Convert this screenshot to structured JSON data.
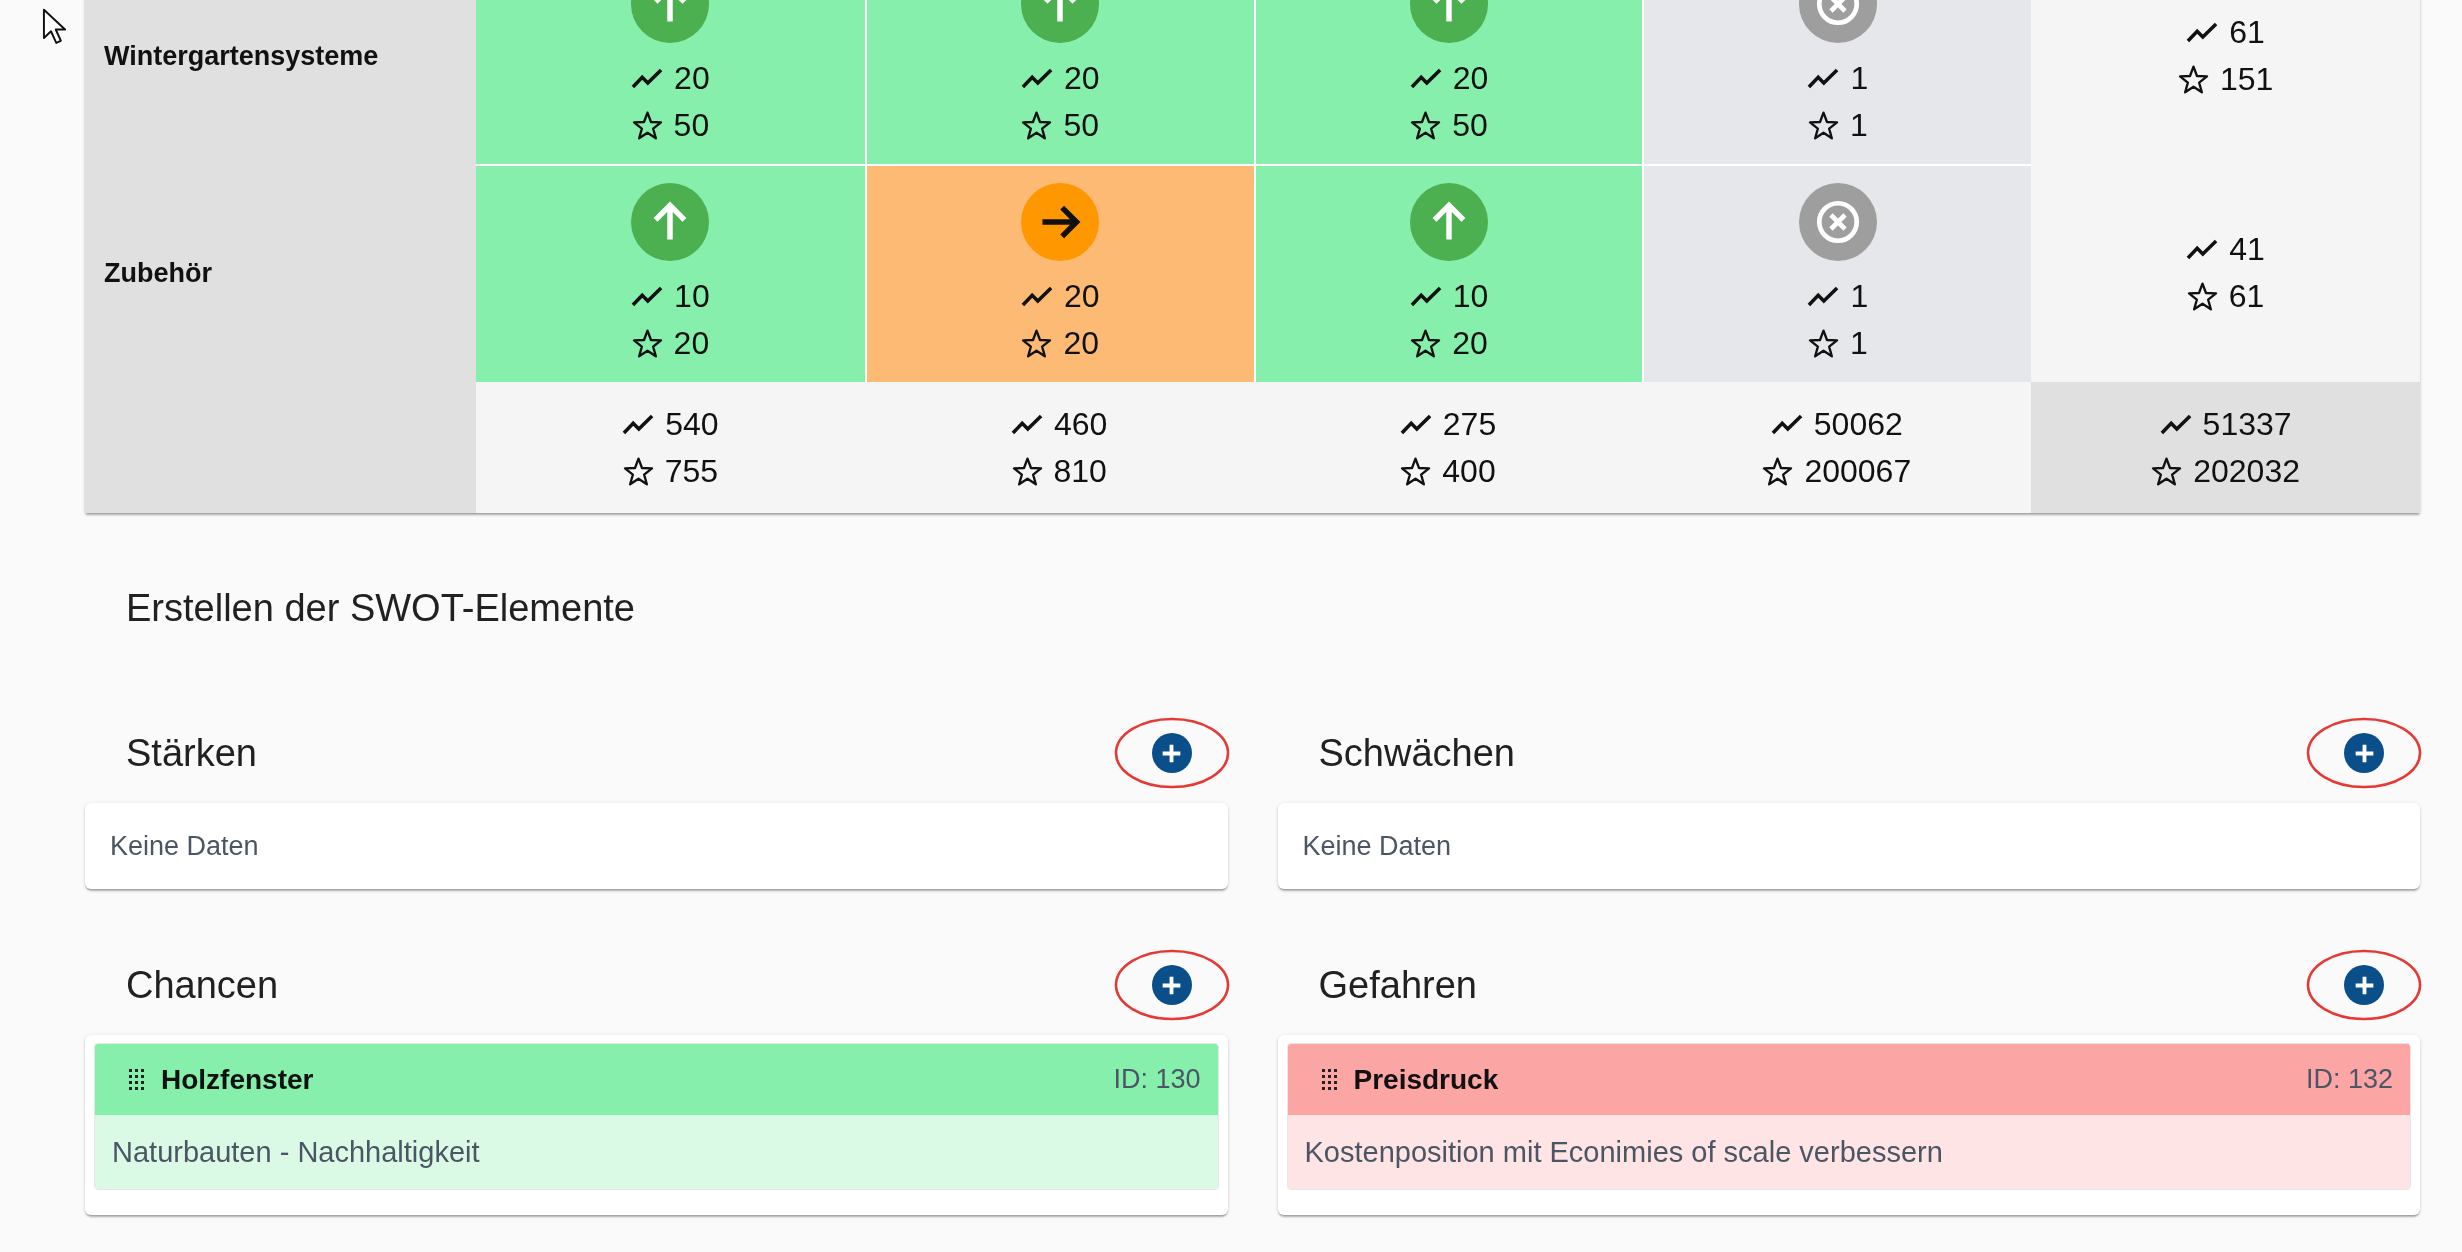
{
  "matrix": {
    "rows": [
      {
        "label": "Wintergartensysteme",
        "cells": [
          {
            "kind": "up",
            "trend_value": "20",
            "star_value": "50"
          },
          {
            "kind": "up",
            "trend_value": "20",
            "star_value": "50"
          },
          {
            "kind": "up",
            "trend_value": "20",
            "star_value": "50"
          },
          {
            "kind": "off",
            "trend_value": "1",
            "star_value": "1"
          }
        ],
        "total": {
          "trend_value": "61",
          "star_value": "151"
        }
      },
      {
        "label": "Zubehör",
        "cells": [
          {
            "kind": "up",
            "trend_value": "10",
            "star_value": "20"
          },
          {
            "kind": "right",
            "trend_value": "20",
            "star_value": "20"
          },
          {
            "kind": "up",
            "trend_value": "10",
            "star_value": "20"
          },
          {
            "kind": "off",
            "trend_value": "1",
            "star_value": "1"
          }
        ],
        "total": {
          "trend_value": "41",
          "star_value": "61"
        }
      }
    ],
    "column_totals": [
      {
        "trend_value": "540",
        "star_value": "755"
      },
      {
        "trend_value": "460",
        "star_value": "810"
      },
      {
        "trend_value": "275",
        "star_value": "400"
      },
      {
        "trend_value": "50062",
        "star_value": "200067"
      }
    ],
    "grand_total": {
      "trend_value": "51337",
      "star_value": "202032"
    }
  },
  "swot": {
    "title": "Erstellen der SWOT-Elemente",
    "sections": [
      {
        "heading": "Stärken",
        "annotated": true,
        "empty_text": "Keine Daten"
      },
      {
        "heading": "Schwächen",
        "annotated": true,
        "empty_text": "Keine Daten"
      },
      {
        "heading": "Chancen",
        "annotated": true,
        "items": [
          {
            "title": "Holzfenster",
            "id_label": "ID: 130",
            "description": "Naturbauten - Nachhaltigkeit",
            "color": "#86efac"
          }
        ]
      },
      {
        "heading": "Gefahren",
        "annotated": true,
        "items": [
          {
            "title": "Preisdruck",
            "id_label": "ID: 132",
            "description": "Kostenposition mit Econimies of scale verbessern",
            "color": "#fca5a5"
          }
        ]
      }
    ]
  }
}
